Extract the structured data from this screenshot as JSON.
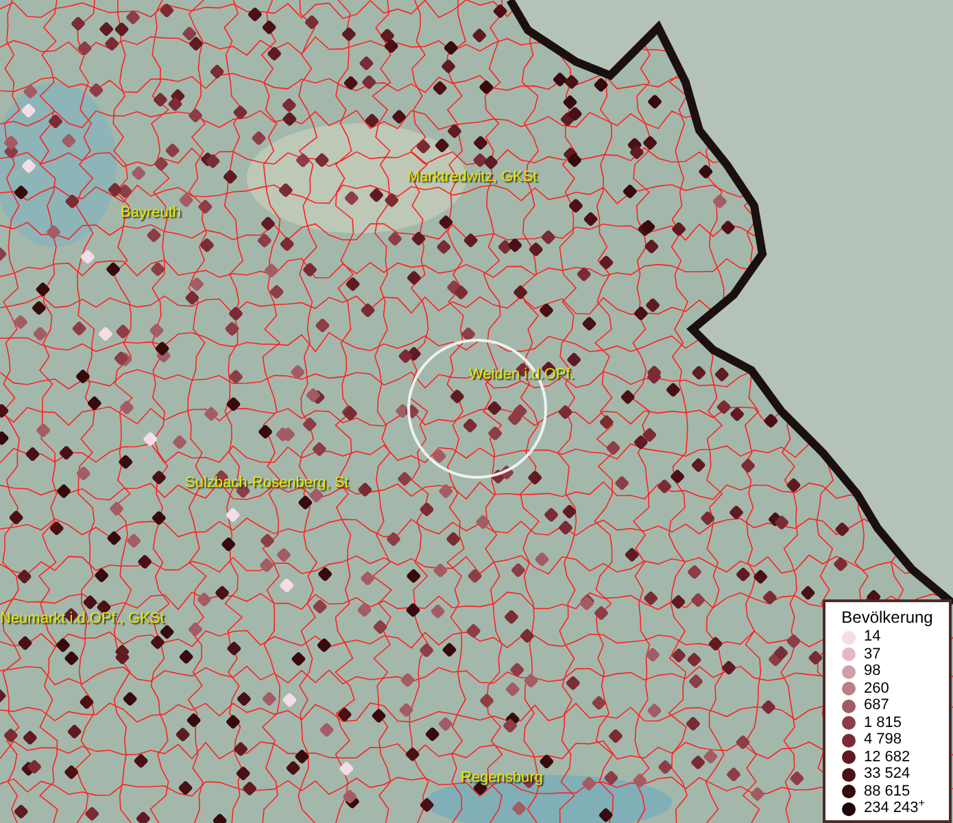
{
  "map_labels": [
    {
      "text": "Bayreuth"
    },
    {
      "text": "Marktredwitz, GKSt"
    },
    {
      "text": "Weiden i.d.OPf."
    },
    {
      "text": "Sulzbach-Rosenberg, St"
    },
    {
      "text": "Neumarkt i.d.OPf., GKSt"
    },
    {
      "text": "Regensburg"
    }
  ],
  "legend": {
    "title": "Bevölkerung",
    "items": [
      {
        "label": "14",
        "color": "#f5dde6"
      },
      {
        "label": "37",
        "color": "#e2b8c2"
      },
      {
        "label": "98",
        "color": "#d09ea6"
      },
      {
        "label": "260",
        "color": "#bb7e86"
      },
      {
        "label": "687",
        "color": "#a35b64"
      },
      {
        "label": "1 815",
        "color": "#8c3d46"
      },
      {
        "label": "4 798",
        "color": "#7a2b33"
      },
      {
        "label": "12 682",
        "color": "#601b22"
      },
      {
        "label": "33 524",
        "color": "#4a1016"
      },
      {
        "label": "88 615",
        "color": "#370a0e"
      },
      {
        "label": "234 243$^{+}$",
        "color": "#1f0507"
      }
    ]
  }
}
